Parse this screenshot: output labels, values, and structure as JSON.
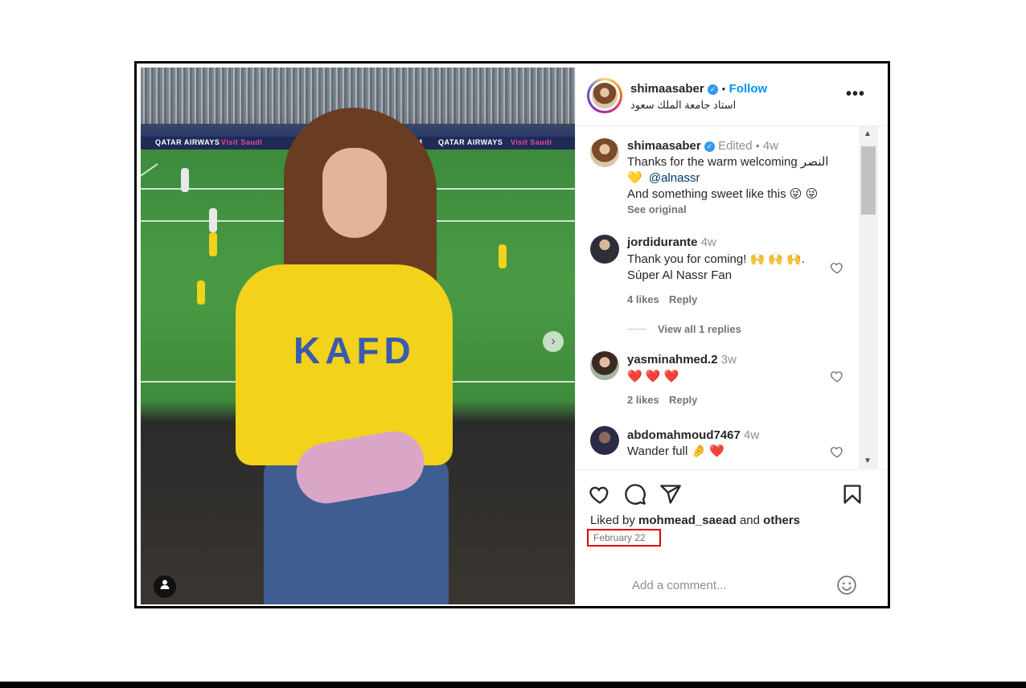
{
  "post": {
    "ads": [
      "QATAR AIRWAYS",
      "Visit Saudi",
      ".COM",
      "QATAR AIRWAYS",
      "Visit Saudi"
    ],
    "jersey_text": "KAFD"
  },
  "header": {
    "username": "shimaasaber",
    "separator": "•",
    "follow_label": "Follow",
    "location": "استاد جامعة الملك سعود",
    "more": "•••"
  },
  "caption": {
    "username": "shimaasaber",
    "edited": "Edited",
    "dot": "•",
    "time": "4w",
    "line1": "Thanks for the warm welcoming النصر",
    "line2_emoji": "💛",
    "line2_mention": "@alnassr",
    "line3": "And something sweet like this 😜 😜",
    "see_original": "See original"
  },
  "comments": [
    {
      "username": "jordidurante",
      "time": "4w",
      "text1": "Thank you for coming! 🙌 🙌 🙌.",
      "text2": "Súper Al Nassr Fan",
      "likes": "4 likes",
      "reply": "Reply",
      "view_replies": "View all 1 replies"
    },
    {
      "username": "yasminahmed.2",
      "time": "3w",
      "text1": "❤️ ❤️ ❤️",
      "likes": "2 likes",
      "reply": "Reply"
    },
    {
      "username": "abdomahmoud7467",
      "time": "4w",
      "text1": "Wander full 🤌 ❤️"
    }
  ],
  "footer": {
    "liked_by_prefix": "Liked by",
    "liked_by_user": "mohmead_saead",
    "liked_by_and": "and",
    "liked_by_others": "others",
    "date": "February 22",
    "add_comment_placeholder": "Add a comment..."
  },
  "colors": {
    "accent": "#0095f6",
    "highlight_box": "#e00000",
    "heart": "#ed4956"
  }
}
